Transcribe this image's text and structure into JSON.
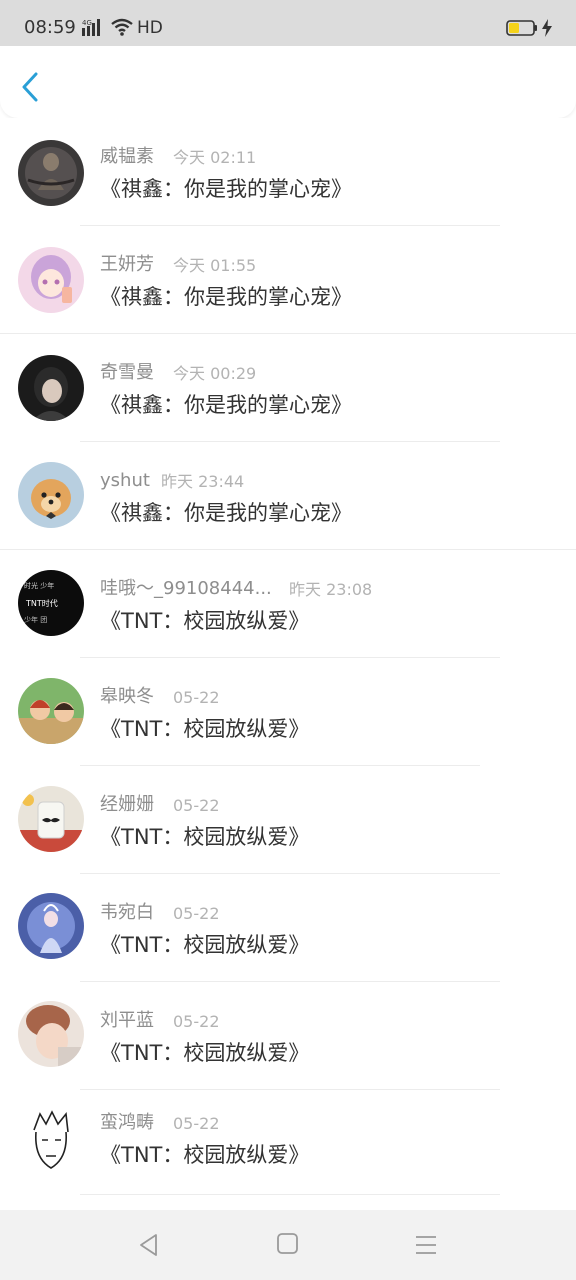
{
  "status_bar": {
    "time": "08:59",
    "network": "4G",
    "hd": "HD",
    "battery_level": 0.4
  },
  "header": {
    "back_icon": "chevron-left-icon",
    "accent_color": "#2a9fd6"
  },
  "items": [
    {
      "name": "威韫素",
      "time": "今天 02:11",
      "title": "《祺鑫：你是我的掌心宠》",
      "avatar": "dark-statue"
    },
    {
      "name": "王妍芳",
      "time": "今天 01:55",
      "title": "《祺鑫：你是我的掌心宠》",
      "avatar": "anime-pink"
    },
    {
      "name": "奇雪曼",
      "time": "今天 00:29",
      "title": "《祺鑫：你是我的掌心宠》",
      "avatar": "dark-girl"
    },
    {
      "name": "yshut",
      "time": "昨天 23:44",
      "title": "《祺鑫：你是我的掌心宠》",
      "avatar": "pomeranian"
    },
    {
      "name": "哇哦～_99108444...",
      "time": "昨天 23:08",
      "title": "《TNT：校园放纵爱》",
      "avatar": "black-text"
    },
    {
      "name": "皋映冬",
      "time": "05-22",
      "title": "《TNT：校园放纵爱》",
      "avatar": "cartoon-kids"
    },
    {
      "name": "经姗姗",
      "time": "05-22",
      "title": "《TNT：校园放纵爱》",
      "avatar": "milk-jar"
    },
    {
      "name": "韦宛白",
      "time": "05-22",
      "title": "《TNT：校园放纵爱》",
      "avatar": "fantasy-blue"
    },
    {
      "name": "刘平蓝",
      "time": "05-22",
      "title": "《TNT：校园放纵爱》",
      "avatar": "soft-portrait"
    },
    {
      "name": "蛮鸿畴",
      "time": "05-22",
      "title": "《TNT：校园放纵爱》",
      "avatar": "sketch-face"
    }
  ]
}
